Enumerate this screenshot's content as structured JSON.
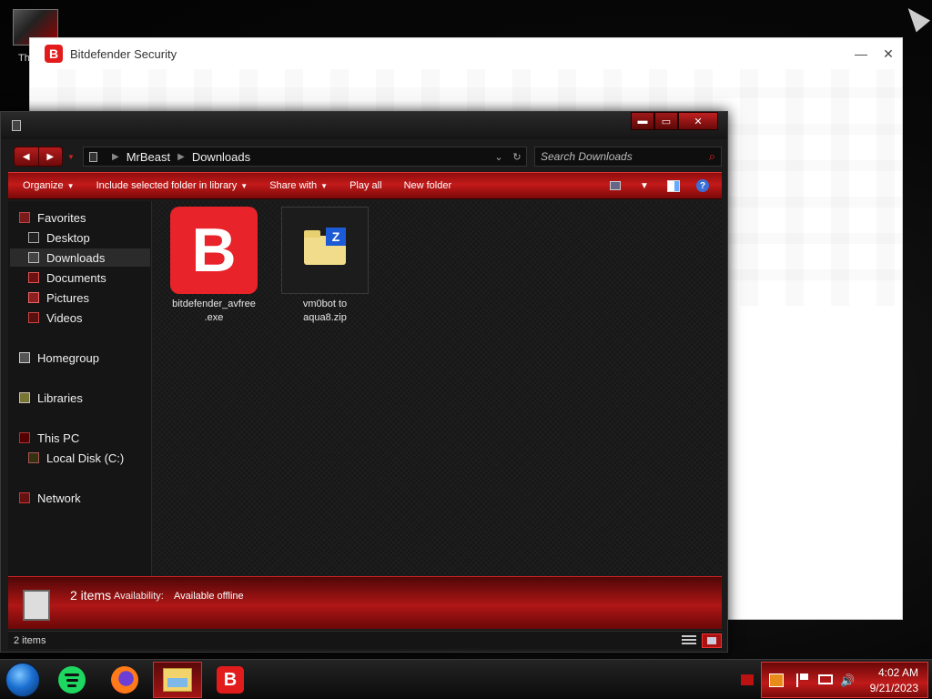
{
  "desktop": {
    "icon_label": "Th"
  },
  "bitdefender_window": {
    "title": "Bitdefender Security",
    "logo_letter": "B",
    "minimize": "—",
    "close": "✕"
  },
  "explorer": {
    "window_controls": {
      "minimize": "▬",
      "maximize": "▭",
      "close": "✕"
    },
    "nav": {
      "back": "◀",
      "forward": "▶",
      "recent": "▼"
    },
    "breadcrumb": [
      "MrBeast",
      "Downloads"
    ],
    "breadcrumb_sep": "▶",
    "address_dropdown": "⌄",
    "refresh": "↻",
    "search_placeholder": "Search Downloads",
    "search_icon": "⌕",
    "toolbar": {
      "organize": "Organize",
      "include": "Include selected folder in library",
      "share": "Share with",
      "play_all": "Play all",
      "new_folder": "New folder",
      "dropdown_arrow": "▼",
      "help": "?"
    },
    "nav_pane": {
      "favorites": "Favorites",
      "desktop": "Desktop",
      "downloads": "Downloads",
      "documents": "Documents",
      "pictures": "Pictures",
      "videos": "Videos",
      "homegroup": "Homegroup",
      "libraries": "Libraries",
      "this_pc": "This PC",
      "local_disk": "Local Disk (C:)",
      "network": "Network"
    },
    "files": [
      {
        "name_line1": "bitdefender_avfree",
        "name_line2": ".exe",
        "icon": "bitdefender-icon",
        "letter": "B"
      },
      {
        "name_line1": "vm0bot to",
        "name_line2": "aqua8.zip",
        "icon": "zip-folder-icon",
        "letter": "Z"
      }
    ],
    "details_pane": {
      "count": "2 items",
      "availability_label": "Availability:",
      "availability_value": "Available offline"
    },
    "status": {
      "items": "2 items"
    }
  },
  "taskbar": {
    "apps": [
      "start",
      "spotify",
      "firefox",
      "file-explorer",
      "bitdefender"
    ],
    "bitdefender_letter": "B",
    "tray_volume": "🔊",
    "clock": {
      "time": "4:02 AM",
      "date": "9/21/2023"
    }
  },
  "colors": {
    "accent_red": "#c41a1a",
    "bitdefender_red": "#e21c1c",
    "explorer_bg": "#1b1b1b"
  }
}
